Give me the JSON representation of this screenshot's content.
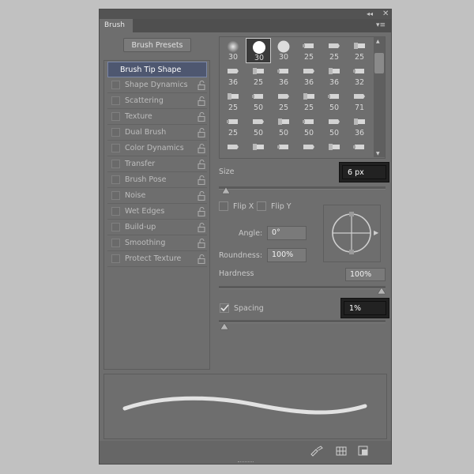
{
  "panel": {
    "tab_label": "Brush",
    "collapse_icon": "double-chevron-left-icon",
    "close_icon": "close-icon",
    "menu_icon": "panel-menu-icon"
  },
  "presets_button": "Brush Presets",
  "sidebar": {
    "items": [
      {
        "label": "Brush Tip Shape",
        "selected": true,
        "checkbox": false,
        "lock": false
      },
      {
        "label": "Shape Dynamics",
        "checkbox": true,
        "lock": true
      },
      {
        "label": "Scattering",
        "checkbox": true,
        "lock": true
      },
      {
        "label": "Texture",
        "checkbox": true,
        "lock": true
      },
      {
        "label": "Dual Brush",
        "checkbox": true,
        "lock": true
      },
      {
        "label": "Color Dynamics",
        "checkbox": true,
        "lock": true
      },
      {
        "label": "Transfer",
        "checkbox": true,
        "lock": true
      },
      {
        "label": "Brush Pose",
        "checkbox": true,
        "lock": true
      },
      {
        "label": "Noise",
        "checkbox": true,
        "lock": true
      },
      {
        "label": "Wet Edges",
        "checkbox": true,
        "lock": true
      },
      {
        "label": "Build-up",
        "checkbox": true,
        "lock": true
      },
      {
        "label": "Smoothing",
        "checkbox": true,
        "lock": true
      },
      {
        "label": "Protect Texture",
        "checkbox": true,
        "lock": true
      }
    ]
  },
  "tips": {
    "rows": [
      [
        "30",
        "30",
        "30",
        "25",
        "25",
        "25"
      ],
      [
        "36",
        "25",
        "36",
        "36",
        "36",
        "32"
      ],
      [
        "25",
        "50",
        "25",
        "25",
        "50",
        "71"
      ],
      [
        "25",
        "50",
        "50",
        "50",
        "50",
        "36"
      ],
      [
        "",
        "",
        "",
        "",
        "",
        ""
      ]
    ],
    "selected_index": 1
  },
  "size": {
    "label": "Size",
    "value": "6 px",
    "slider_fraction": 0.02
  },
  "flip_x": {
    "label": "Flip X",
    "checked": false
  },
  "flip_y": {
    "label": "Flip Y",
    "checked": false
  },
  "angle": {
    "label": "Angle:",
    "value": "0°"
  },
  "roundness": {
    "label": "Roundness:",
    "value": "100%"
  },
  "hardness": {
    "label": "Hardness",
    "value": "100%",
    "slider_fraction": 1.0
  },
  "spacing": {
    "label": "Spacing",
    "value": "1%",
    "checked": true,
    "slider_fraction": 0.01
  },
  "bottom_icons": [
    "create-new-brush-icon",
    "grid-icon",
    "new-preset-icon"
  ]
}
